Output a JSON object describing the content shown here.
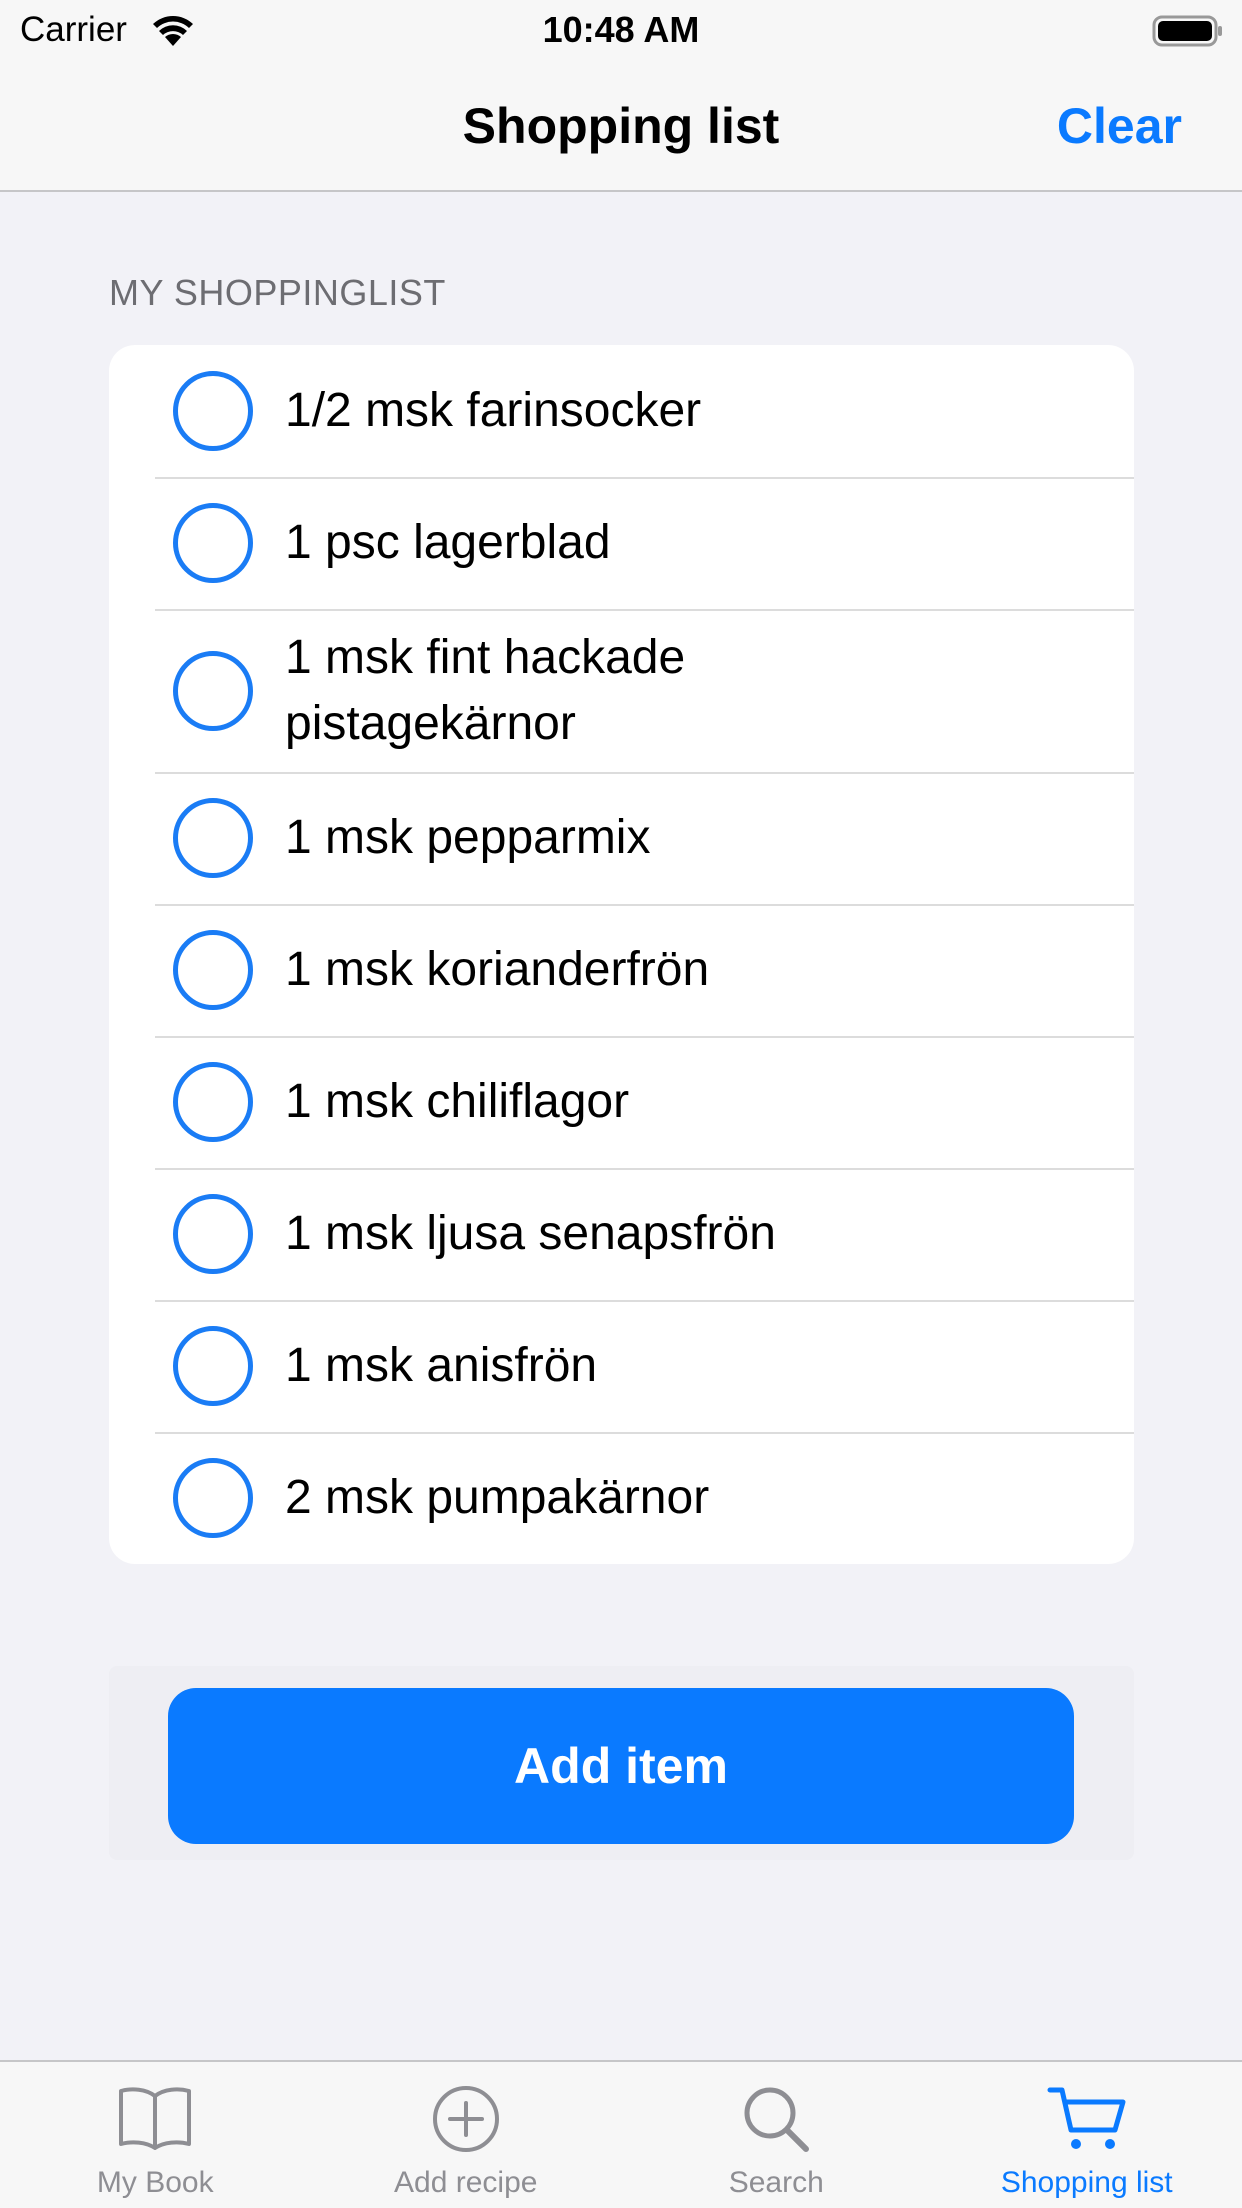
{
  "status_bar": {
    "carrier": "Carrier",
    "time": "10:48 AM"
  },
  "nav": {
    "title": "Shopping list",
    "clear_label": "Clear"
  },
  "section": {
    "header": "MY SHOPPINGLIST"
  },
  "items": [
    {
      "text": " 1/2 msk farinsocker",
      "checked": false
    },
    {
      "text": "1 psc lagerblad",
      "checked": false
    },
    {
      "text": " 1 msk fint hackade pistagekärnor",
      "checked": false
    },
    {
      "text": " 1 msk pepparmix",
      "checked": false
    },
    {
      "text": " 1 msk korianderfrön",
      "checked": false
    },
    {
      "text": " 1 msk chiliflagor",
      "checked": false
    },
    {
      "text": " 1 msk ljusa senapsfrön",
      "checked": false
    },
    {
      "text": " 1 msk anisfrön",
      "checked": false
    },
    {
      "text": " 2 msk pumpakärnor",
      "checked": false
    }
  ],
  "add_item_label": "Add item",
  "tabs": [
    {
      "label": "My Book",
      "icon": "book-icon",
      "active": false
    },
    {
      "label": "Add recipe",
      "icon": "plus-circle-icon",
      "active": false
    },
    {
      "label": "Search",
      "icon": "search-icon",
      "active": false
    },
    {
      "label": "Shopping list",
      "icon": "cart-icon",
      "active": true
    }
  ],
  "colors": {
    "accent": "#0a7aff",
    "background": "#f2f2f7",
    "inactive_tab": "#8e8e93"
  }
}
